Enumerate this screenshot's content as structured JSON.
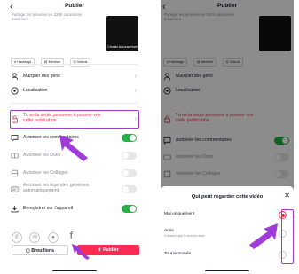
{
  "left": {
    "title": "Publier",
    "back_icon": "chevron-left-icon",
    "caption_placeholder": "Partage tes pensées en 2200 caractères maximum",
    "cover_label": "Choisis la couverture",
    "chips": [
      "# Hashtags",
      "@ Mention",
      "◎ Vidéos"
    ],
    "rows": [
      {
        "icon": "person-icon",
        "label": "Marquer des gens",
        "control": "chevron"
      },
      {
        "icon": "location-icon",
        "label": "Localisation",
        "control": "chevron"
      },
      {
        "icon": "lock-icon",
        "label": "Tu es la seule personne à pouvoir voir cette publication",
        "control": "chevron",
        "style": "red"
      },
      {
        "icon": "comment-icon",
        "label": "Autoriser les commentaires",
        "control": "toggle",
        "on": true
      },
      {
        "icon": "duo-icon",
        "label": "Autoriser les Duos",
        "control": "toggle",
        "on": false,
        "style": "muted"
      },
      {
        "icon": "stitch-icon",
        "label": "Autoriser les Collages",
        "control": "toggle",
        "on": false,
        "style": "muted"
      },
      {
        "icon": "caption-icon",
        "label": "Autoriser les légendes générées automatiquement",
        "control": "toggle",
        "on": false,
        "style": "muted"
      },
      {
        "icon": "download-icon",
        "label": "Enregistrer sur l'appareil",
        "control": "toggle",
        "on": true
      }
    ],
    "share_icons": [
      "whatsapp-icon",
      "messenger-icon",
      "message-icon",
      "facebook-icon"
    ],
    "drafts_label": "Brouillons",
    "publish_label": "Publier",
    "accent": "#fe2c55",
    "toggle_on_color": "#22b148",
    "highlight_color": "#a03ad8"
  },
  "right": {
    "title": "Publier",
    "caption_placeholder": "Partage tes pensées en 2200 caractères maximum",
    "chips": [
      "# Hashtags",
      "@ Mention",
      "◎ Vidéos"
    ],
    "rows": [
      {
        "icon": "person-icon",
        "label": "Marquer des gens"
      },
      {
        "icon": "location-icon",
        "label": "Localisation"
      },
      {
        "icon": "lock-icon",
        "label": "Tu es la seule personne à pouvoir voir cette publication"
      },
      {
        "icon": "comment-icon",
        "label": "Autoriser les commentaires"
      },
      {
        "icon": "duo-icon",
        "label": "Autoriser les Duos"
      },
      {
        "icon": "stitch-icon",
        "label": "Autoriser les Collages"
      }
    ],
    "sheet": {
      "title": "Qui peut regarder cette vidéo",
      "options": [
        {
          "label": "Moi uniquement",
          "sub": "",
          "selected": true
        },
        {
          "label": "Amis",
          "sub": "Followers que tu suis en retour",
          "selected": false
        },
        {
          "label": "Tout le monde",
          "sub": "",
          "selected": false
        }
      ]
    }
  }
}
